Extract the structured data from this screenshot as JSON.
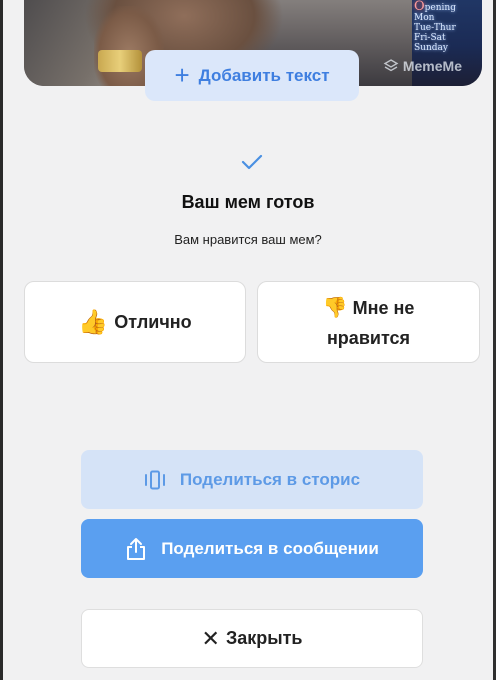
{
  "image": {
    "add_text_label": "Добавить текст",
    "add_text_icon": "plus-icon",
    "watermark": "MemeMe",
    "neon_sign": {
      "line1_first": "O",
      "line1_rest": "pening",
      "line2": "Mon",
      "line3": "Tue-Thur",
      "line4": "Fri-Sat",
      "line5": "Sunday"
    }
  },
  "status": {
    "check_icon": "checkmark-icon",
    "title": "Ваш мем готов",
    "question": "Вам нравится ваш мем?"
  },
  "rating": {
    "like_emoji": "👍",
    "like_label": "Отлично",
    "dislike_emoji": "👎",
    "dislike_label_line1": "Мне не",
    "dislike_label_line2": "нравится"
  },
  "actions": {
    "share_stories_label": "Поделиться в сторис",
    "share_stories_icon": "stories-icon",
    "share_message_label": "Поделиться в сообщении",
    "share_message_icon": "share-icon",
    "close_label": "Закрыть",
    "close_icon": "close-icon"
  },
  "colors": {
    "accent": "#5a9ff0",
    "accent_light": "#d5e3f7",
    "add_text_bg": "#dbe7fa",
    "add_text_fg": "#3f7fe0",
    "background": "#f1f1f2"
  }
}
